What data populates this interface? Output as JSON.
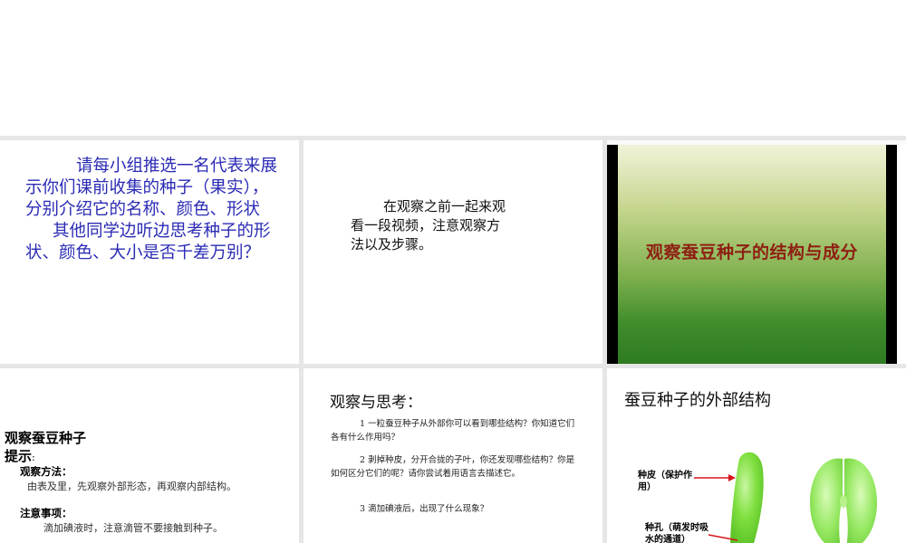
{
  "slides": {
    "s1": {
      "lines": [
        "请每小组推选一名代表来展示你们课前收集的种子（果实），分别介绍它的名称、颜色、形状",
        "其他同学边听边思考种子的形状、颜色、大小是否千差万别？"
      ]
    },
    "s2": {
      "text": "在观察之前一起来观看一段视频，注意观察方法以及步骤。"
    },
    "s3": {
      "video_title": "观察蚕豆种子的结构与成分"
    },
    "s4": {
      "title": "观察蚕豆种子",
      "hint_label": "提示",
      "hint_colon": ":",
      "method_label": "观察方法：",
      "method_text": "由表及里，先观察外部形态，再观察内部结构。",
      "notes_label": "注意事项：",
      "notes_text": "滴加碘液时，注意滴管不要接触到种子。"
    },
    "s5": {
      "title": "观察与思考：",
      "questions": [
        "1 一粒蚕豆种子从外部你可以看到哪些结构？你知道它们各有什么作用吗？",
        "2 剥掉种皮，分开合拢的子叶，你还发现哪些结构？你是如何区分它们的呢？请你尝试着用语言去描述它。",
        "3 滴加碘液后，出现了什么现象？"
      ]
    },
    "s6": {
      "title": "蚕豆种子的外部结构",
      "labels": {
        "seed_coat": "种皮（保护作用）",
        "hilum": "种孔（萌发时吸水的通道）"
      }
    }
  },
  "colors": {
    "s1_text": "#2b2bb5",
    "video_title": "#8e1f12",
    "seed_green": "#7ee040",
    "arrow_red": "#d8141e"
  }
}
